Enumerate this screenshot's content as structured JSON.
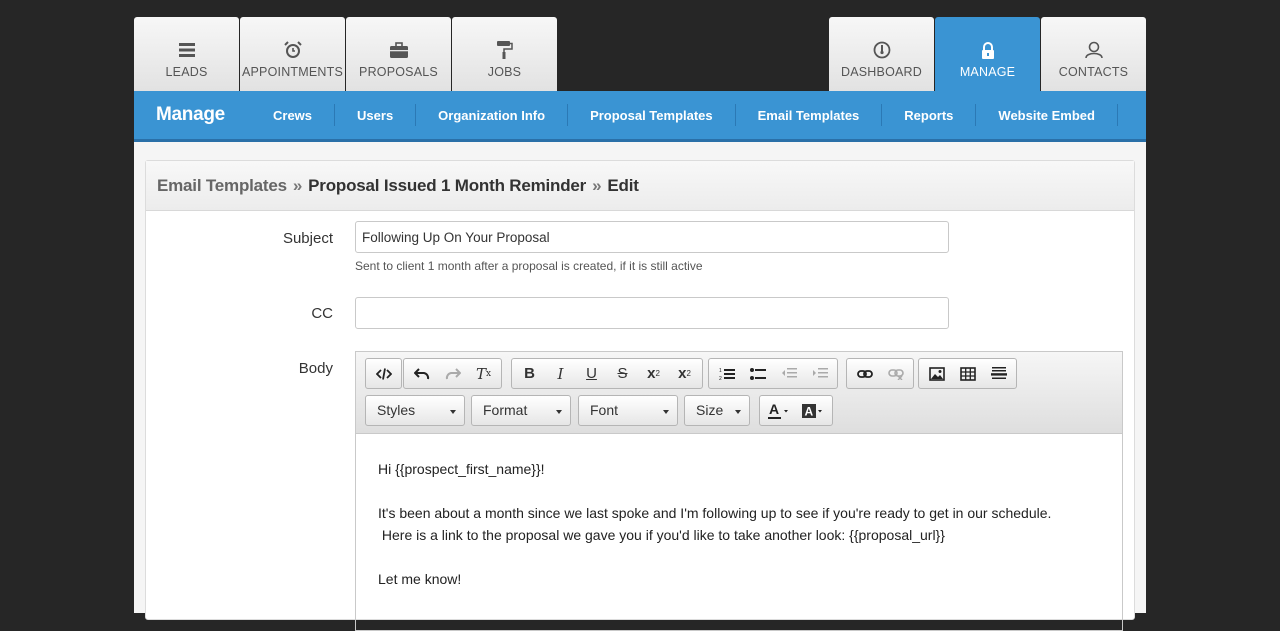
{
  "tabs_left": [
    {
      "label": "LEADS",
      "icon": "leads-icon"
    },
    {
      "label": "APPOINTMENTS",
      "icon": "alarm-clock-icon"
    },
    {
      "label": "PROPOSALS",
      "icon": "briefcase-icon"
    },
    {
      "label": "JOBS",
      "icon": "paint-roller-icon"
    }
  ],
  "tabs_right": [
    {
      "label": "DASHBOARD",
      "icon": "dashboard-gauge-icon"
    },
    {
      "label": "MANAGE",
      "icon": "lock-icon",
      "active": true
    },
    {
      "label": "CONTACTS",
      "icon": "contacts-icon"
    }
  ],
  "subnav": {
    "title": "Manage",
    "items": [
      "Crews",
      "Users",
      "Organization Info",
      "Proposal Templates",
      "Email Templates",
      "Reports",
      "Website Embed"
    ]
  },
  "breadcrumb": {
    "root": "Email Templates",
    "sep": "»",
    "current": "Proposal Issued 1 Month Reminder",
    "action": "Edit"
  },
  "form": {
    "subject_label": "Subject",
    "subject_value": "Following Up On Your Proposal",
    "subject_help": "Sent to client 1 month after a proposal is created, if it is still active",
    "cc_label": "CC",
    "cc_value": "",
    "body_label": "Body"
  },
  "editor": {
    "selects": [
      "Styles",
      "Format",
      "Font",
      "Size"
    ],
    "body_lines": [
      "Hi {{prospect_first_name}}!",
      "",
      "It's been about a month since we last spoke and I'm following up to see if you're ready to get in our schedule.",
      " Here is a link to the proposal we gave you if you'd like to take another look: {{proposal_url}}",
      "",
      "Let me know!"
    ]
  },
  "colors": {
    "accent": "#3a94d3",
    "background": "#262626"
  }
}
